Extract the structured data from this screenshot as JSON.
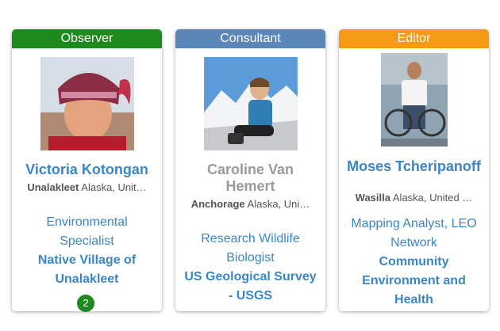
{
  "cards": [
    {
      "role": "Observer",
      "role_color": "#1e8a1e",
      "name": "Victoria Kotongan",
      "name_color": "#3a86c4",
      "city": "Unalakleet",
      "region": "Alaska, Unit…",
      "title": "Environmental Specialist",
      "org": "Native Village of Unalakleet",
      "badge": "2"
    },
    {
      "role": "Consultant",
      "role_color": "#5b87b8",
      "name": "Caroline Van Hemert",
      "name_color": "#9a9a9a",
      "city": "Anchorage",
      "region": "Alaska, Uni…",
      "title": "Research Wildlife Biologist",
      "org": "US Geological Survey - USGS"
    },
    {
      "role": "Editor",
      "role_color": "#f59a12",
      "name": "Moses Tcheripanoff",
      "name_color": "#3a86c4",
      "city": "Wasilla",
      "region": "Alaska, United …",
      "title": "Mapping Analyst, LEO Network",
      "org": "Community Environment and Health"
    }
  ]
}
